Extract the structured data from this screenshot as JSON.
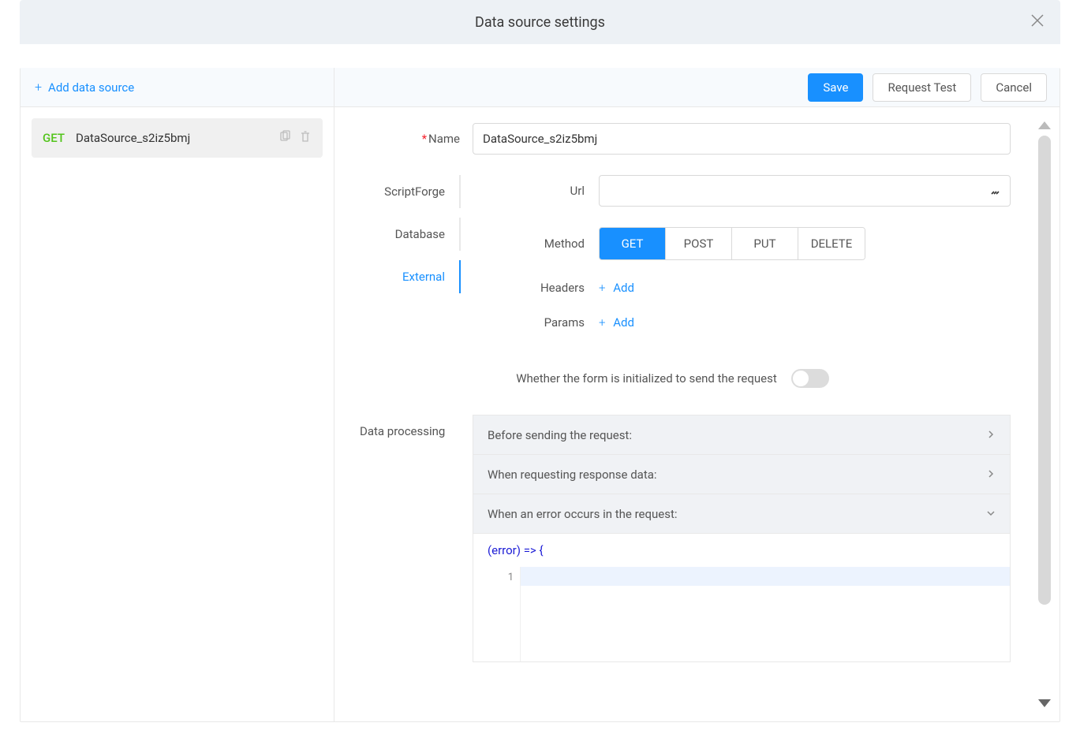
{
  "modal": {
    "title": "Data source settings"
  },
  "sidebar": {
    "add_label": "Add data source",
    "items": [
      {
        "method": "GET",
        "name": "DataSource_s2iz5bmj"
      }
    ]
  },
  "toolbar": {
    "save_label": "Save",
    "request_test_label": "Request Test",
    "cancel_label": "Cancel"
  },
  "form": {
    "name_label": "Name",
    "name_value": "DataSource_s2iz5bmj",
    "tabs": {
      "scriptforge": "ScriptForge",
      "database": "Database",
      "external": "External"
    },
    "url_label": "Url",
    "url_value": "",
    "method_label": "Method",
    "methods": {
      "get": "GET",
      "post": "POST",
      "put": "PUT",
      "delete": "DELETE"
    },
    "headers_label": "Headers",
    "params_label": "Params",
    "add_label": "Add",
    "init_label": "Whether the form is initialized to send the request",
    "dp_label": "Data processing",
    "dp_before": "Before sending the request:",
    "dp_response": "When requesting response data:",
    "dp_error": "When an error occurs in the request:",
    "error_sig": "(error) => {",
    "gutter_1": "1"
  }
}
